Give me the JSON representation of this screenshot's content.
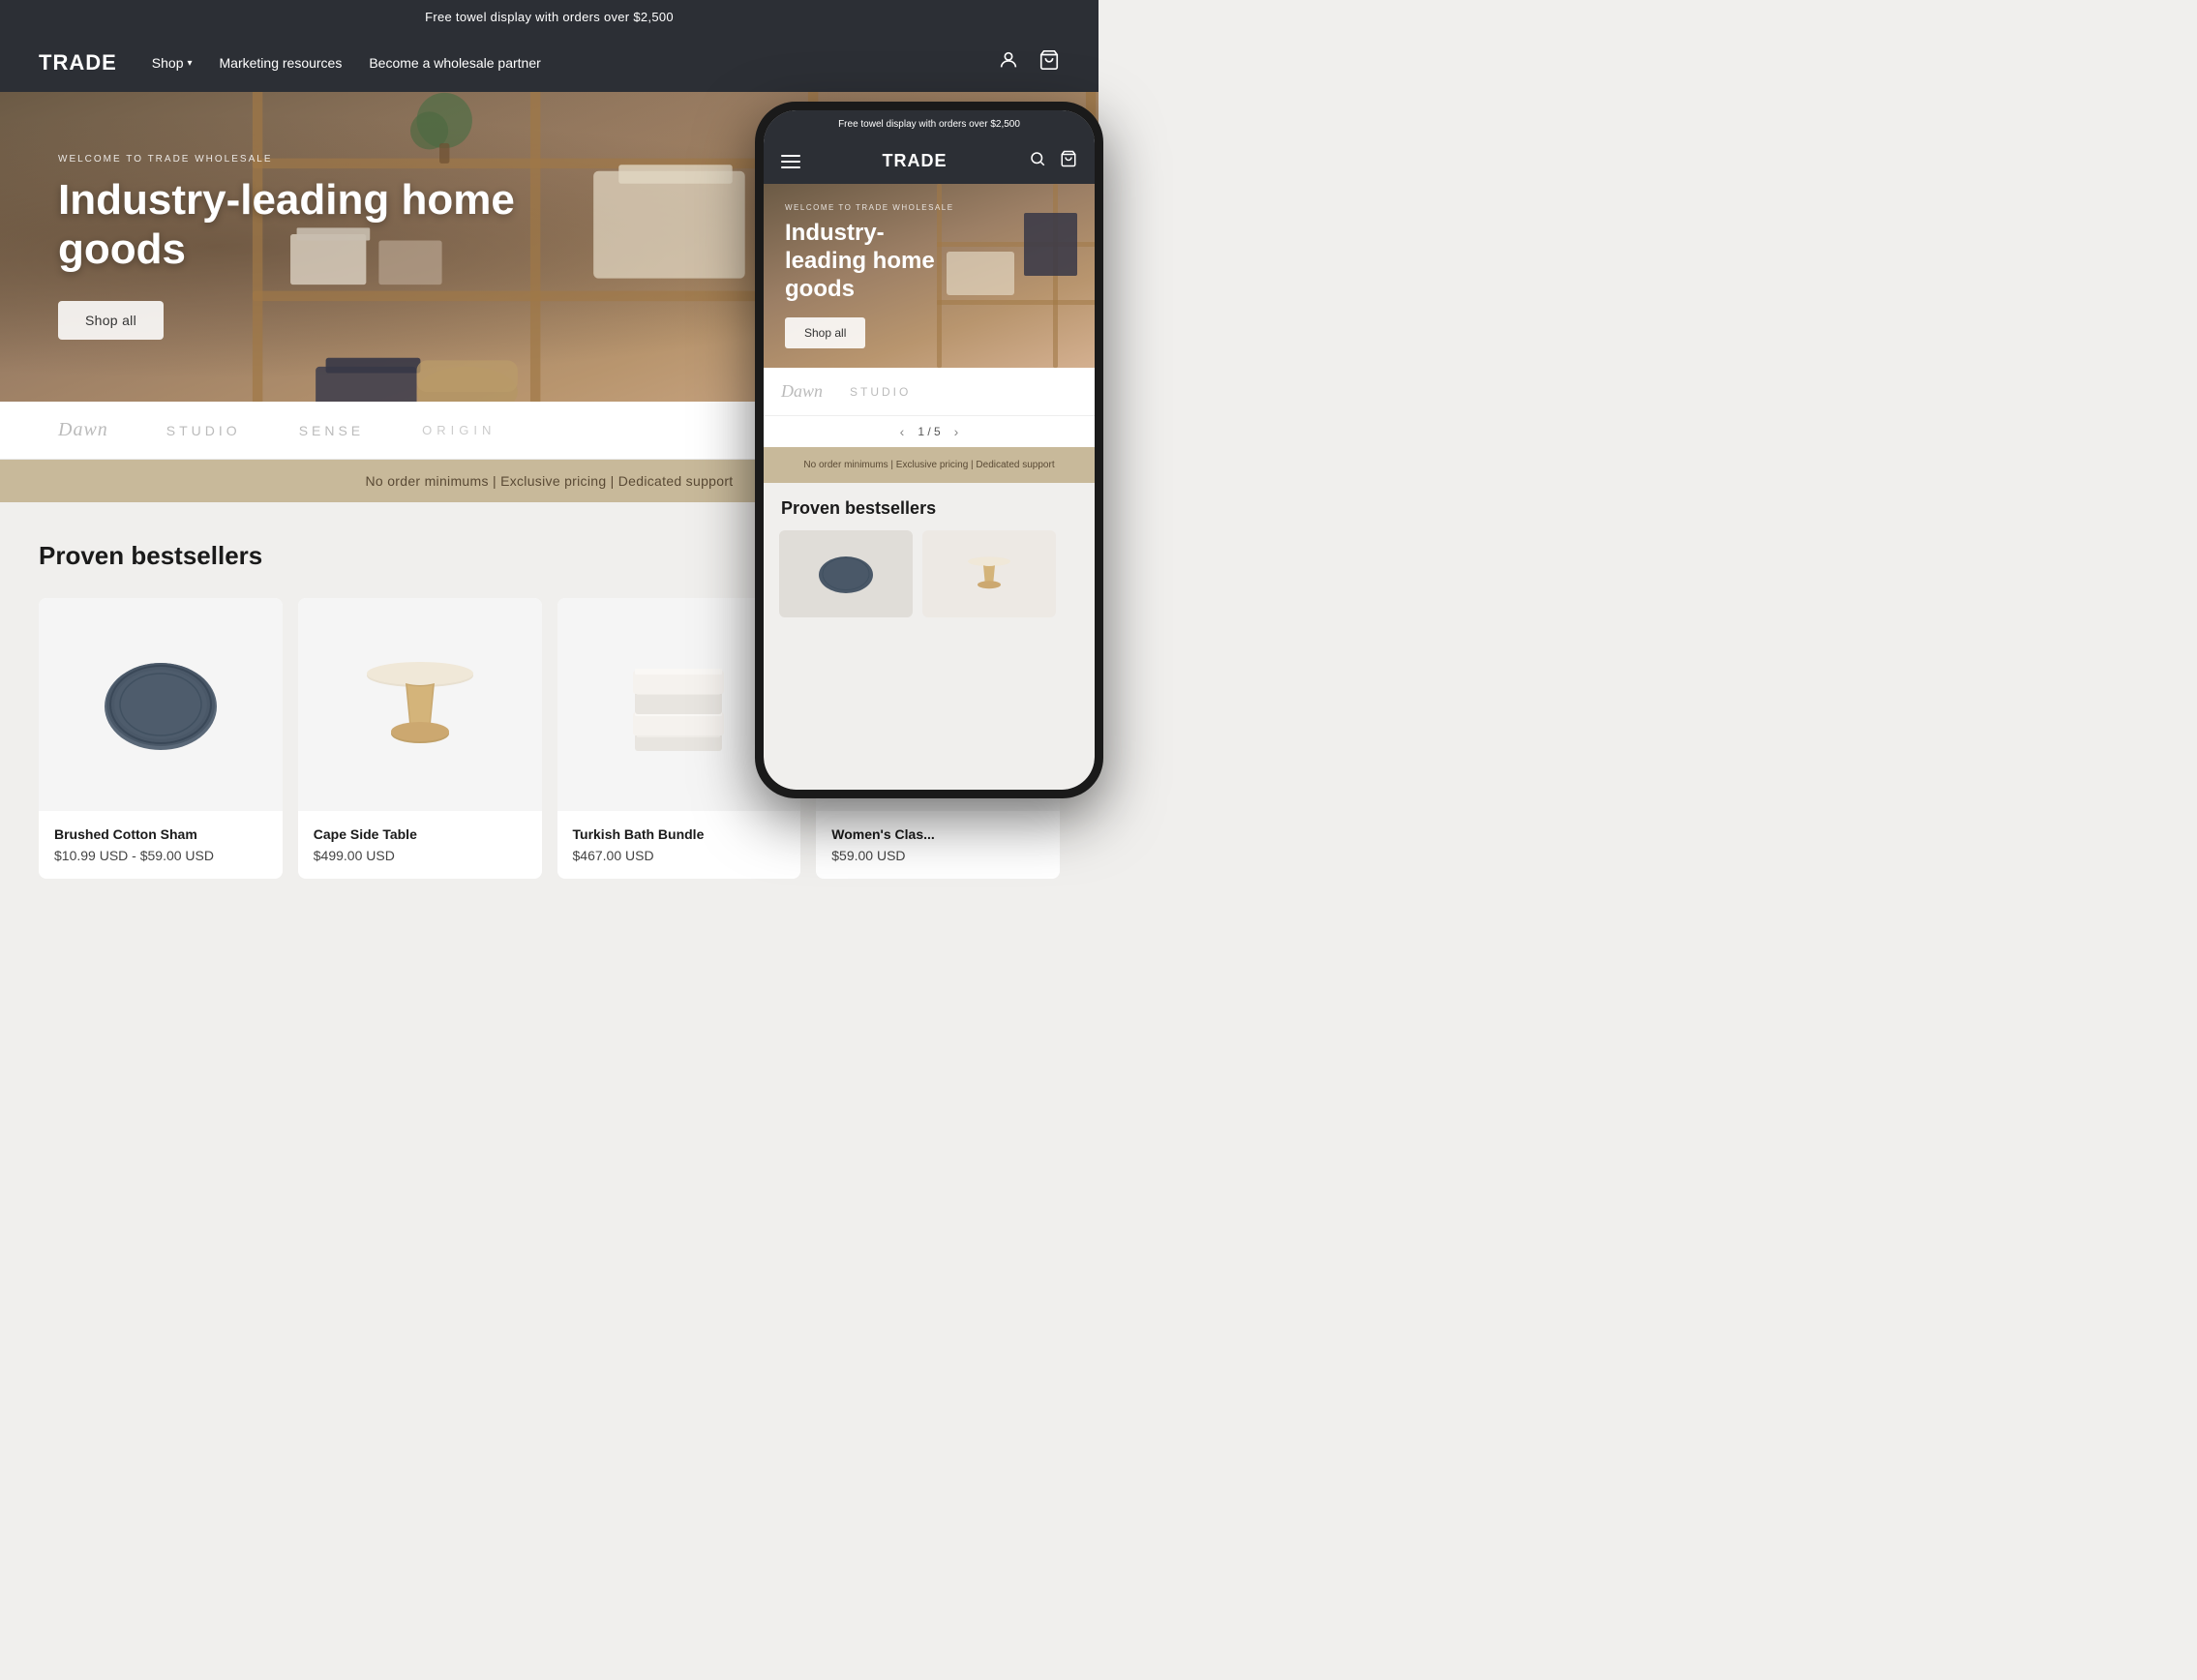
{
  "announcement": {
    "text": "Free towel display with orders over $2,500"
  },
  "header": {
    "logo": "TRADE",
    "nav": [
      {
        "label": "Shop",
        "has_dropdown": true
      },
      {
        "label": "Marketing resources",
        "has_dropdown": false
      },
      {
        "label": "Become a wholesale partner",
        "has_dropdown": false
      }
    ],
    "icons": {
      "account": "account-icon",
      "cart": "cart-icon"
    }
  },
  "hero": {
    "eyebrow": "WELCOME TO TRADE WHOLESALE",
    "title": "Industry-leading home goods",
    "cta_label": "Shop all"
  },
  "brands": [
    {
      "name": "Dawn",
      "style": "serif"
    },
    {
      "name": "STUDIO",
      "style": "sans-spaced"
    },
    {
      "name": "SENSE",
      "style": "sans-spaced"
    },
    {
      "name": "ORIGIN",
      "style": "outlined"
    }
  ],
  "value_bar": {
    "text": "No order minimums | Exclusive pricing | Dedicated support"
  },
  "bestsellers": {
    "title": "Proven bestsellers",
    "products": [
      {
        "name": "Brushed Cotton Sham",
        "price": "$10.99 USD - $59.00 USD",
        "image_type": "pillow"
      },
      {
        "name": "Cape Side Table",
        "price": "$499.00 USD",
        "image_type": "table"
      },
      {
        "name": "Turkish Bath Bundle",
        "price": "$467.00 USD",
        "image_type": "towel"
      },
      {
        "name": "Women's Clas...",
        "price": "$59.00 USD",
        "image_type": "clothing"
      }
    ]
  },
  "mobile": {
    "announcement": "Free towel display with orders over $2,500",
    "logo": "TRADE",
    "hero_eyebrow": "WELCOME TO TRADE WHOLESALE",
    "hero_title": "Industry-leading home goods",
    "cta_label": "Shop all",
    "brands": [
      "Dawn",
      "STUDIO"
    ],
    "pagination": "1 / 5",
    "value_bar": "No order minimums | Exclusive pricing | Dedicated support",
    "bestsellers_title": "Proven bestsellers"
  }
}
